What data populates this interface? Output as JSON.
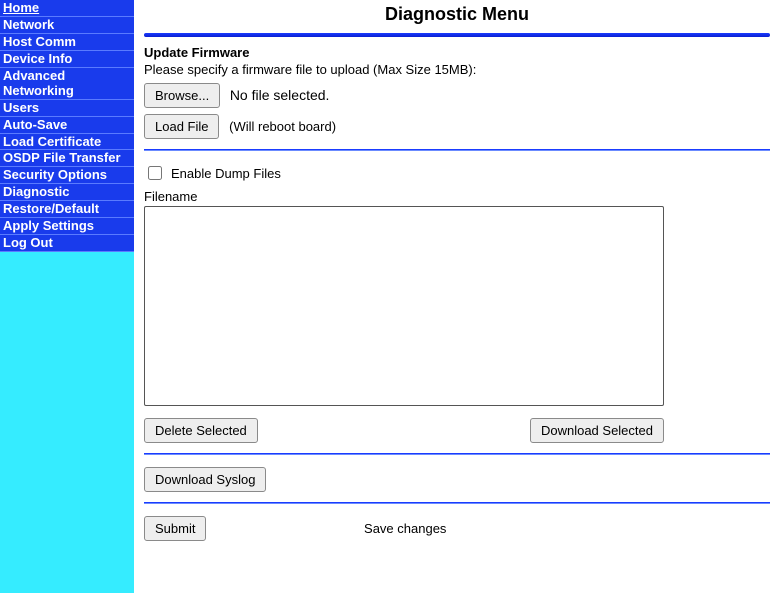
{
  "sidebar": {
    "items": [
      {
        "label": "Home"
      },
      {
        "label": "Network"
      },
      {
        "label": "Host Comm"
      },
      {
        "label": "Device Info"
      },
      {
        "label": "Advanced Networking"
      },
      {
        "label": "Users"
      },
      {
        "label": "Auto-Save"
      },
      {
        "label": "Load Certificate"
      },
      {
        "label": "OSDP File Transfer"
      },
      {
        "label": "Security Options"
      },
      {
        "label": "Diagnostic"
      },
      {
        "label": "Restore/Default"
      },
      {
        "label": "Apply Settings"
      },
      {
        "label": "Log Out"
      }
    ]
  },
  "page": {
    "title": "Diagnostic Menu"
  },
  "firmware": {
    "heading": "Update Firmware",
    "hint": "Please specify a firmware file to upload (Max Size 15MB):",
    "browse_label": "Browse...",
    "file_status": "No file selected.",
    "load_label": "Load File",
    "load_note": "(Will reboot board)"
  },
  "dump": {
    "enable_label": "Enable Dump Files",
    "filename_label": "Filename",
    "delete_label": "Delete Selected",
    "download_label": "Download Selected"
  },
  "syslog": {
    "download_label": "Download Syslog"
  },
  "submit": {
    "button_label": "Submit",
    "save_label": "Save changes"
  }
}
